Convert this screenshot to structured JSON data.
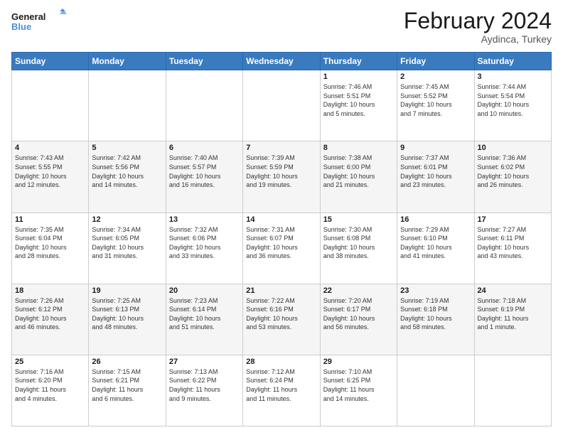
{
  "header": {
    "logo_general": "General",
    "logo_blue": "Blue",
    "month_title": "February 2024",
    "location": "Aydinca, Turkey"
  },
  "calendar": {
    "days_of_week": [
      "Sunday",
      "Monday",
      "Tuesday",
      "Wednesday",
      "Thursday",
      "Friday",
      "Saturday"
    ],
    "weeks": [
      [
        {
          "day": "",
          "info": ""
        },
        {
          "day": "",
          "info": ""
        },
        {
          "day": "",
          "info": ""
        },
        {
          "day": "",
          "info": ""
        },
        {
          "day": "1",
          "info": "Sunrise: 7:46 AM\nSunset: 5:51 PM\nDaylight: 10 hours\nand 5 minutes."
        },
        {
          "day": "2",
          "info": "Sunrise: 7:45 AM\nSunset: 5:52 PM\nDaylight: 10 hours\nand 7 minutes."
        },
        {
          "day": "3",
          "info": "Sunrise: 7:44 AM\nSunset: 5:54 PM\nDaylight: 10 hours\nand 10 minutes."
        }
      ],
      [
        {
          "day": "4",
          "info": "Sunrise: 7:43 AM\nSunset: 5:55 PM\nDaylight: 10 hours\nand 12 minutes."
        },
        {
          "day": "5",
          "info": "Sunrise: 7:42 AM\nSunset: 5:56 PM\nDaylight: 10 hours\nand 14 minutes."
        },
        {
          "day": "6",
          "info": "Sunrise: 7:40 AM\nSunset: 5:57 PM\nDaylight: 10 hours\nand 16 minutes."
        },
        {
          "day": "7",
          "info": "Sunrise: 7:39 AM\nSunset: 5:59 PM\nDaylight: 10 hours\nand 19 minutes."
        },
        {
          "day": "8",
          "info": "Sunrise: 7:38 AM\nSunset: 6:00 PM\nDaylight: 10 hours\nand 21 minutes."
        },
        {
          "day": "9",
          "info": "Sunrise: 7:37 AM\nSunset: 6:01 PM\nDaylight: 10 hours\nand 23 minutes."
        },
        {
          "day": "10",
          "info": "Sunrise: 7:36 AM\nSunset: 6:02 PM\nDaylight: 10 hours\nand 26 minutes."
        }
      ],
      [
        {
          "day": "11",
          "info": "Sunrise: 7:35 AM\nSunset: 6:04 PM\nDaylight: 10 hours\nand 28 minutes."
        },
        {
          "day": "12",
          "info": "Sunrise: 7:34 AM\nSunset: 6:05 PM\nDaylight: 10 hours\nand 31 minutes."
        },
        {
          "day": "13",
          "info": "Sunrise: 7:32 AM\nSunset: 6:06 PM\nDaylight: 10 hours\nand 33 minutes."
        },
        {
          "day": "14",
          "info": "Sunrise: 7:31 AM\nSunset: 6:07 PM\nDaylight: 10 hours\nand 36 minutes."
        },
        {
          "day": "15",
          "info": "Sunrise: 7:30 AM\nSunset: 6:08 PM\nDaylight: 10 hours\nand 38 minutes."
        },
        {
          "day": "16",
          "info": "Sunrise: 7:29 AM\nSunset: 6:10 PM\nDaylight: 10 hours\nand 41 minutes."
        },
        {
          "day": "17",
          "info": "Sunrise: 7:27 AM\nSunset: 6:11 PM\nDaylight: 10 hours\nand 43 minutes."
        }
      ],
      [
        {
          "day": "18",
          "info": "Sunrise: 7:26 AM\nSunset: 6:12 PM\nDaylight: 10 hours\nand 46 minutes."
        },
        {
          "day": "19",
          "info": "Sunrise: 7:25 AM\nSunset: 6:13 PM\nDaylight: 10 hours\nand 48 minutes."
        },
        {
          "day": "20",
          "info": "Sunrise: 7:23 AM\nSunset: 6:14 PM\nDaylight: 10 hours\nand 51 minutes."
        },
        {
          "day": "21",
          "info": "Sunrise: 7:22 AM\nSunset: 6:16 PM\nDaylight: 10 hours\nand 53 minutes."
        },
        {
          "day": "22",
          "info": "Sunrise: 7:20 AM\nSunset: 6:17 PM\nDaylight: 10 hours\nand 56 minutes."
        },
        {
          "day": "23",
          "info": "Sunrise: 7:19 AM\nSunset: 6:18 PM\nDaylight: 10 hours\nand 58 minutes."
        },
        {
          "day": "24",
          "info": "Sunrise: 7:18 AM\nSunset: 6:19 PM\nDaylight: 11 hours\nand 1 minute."
        }
      ],
      [
        {
          "day": "25",
          "info": "Sunrise: 7:16 AM\nSunset: 6:20 PM\nDaylight: 11 hours\nand 4 minutes."
        },
        {
          "day": "26",
          "info": "Sunrise: 7:15 AM\nSunset: 6:21 PM\nDaylight: 11 hours\nand 6 minutes."
        },
        {
          "day": "27",
          "info": "Sunrise: 7:13 AM\nSunset: 6:22 PM\nDaylight: 11 hours\nand 9 minutes."
        },
        {
          "day": "28",
          "info": "Sunrise: 7:12 AM\nSunset: 6:24 PM\nDaylight: 11 hours\nand 11 minutes."
        },
        {
          "day": "29",
          "info": "Sunrise: 7:10 AM\nSunset: 6:25 PM\nDaylight: 11 hours\nand 14 minutes."
        },
        {
          "day": "",
          "info": ""
        },
        {
          "day": "",
          "info": ""
        }
      ]
    ]
  }
}
